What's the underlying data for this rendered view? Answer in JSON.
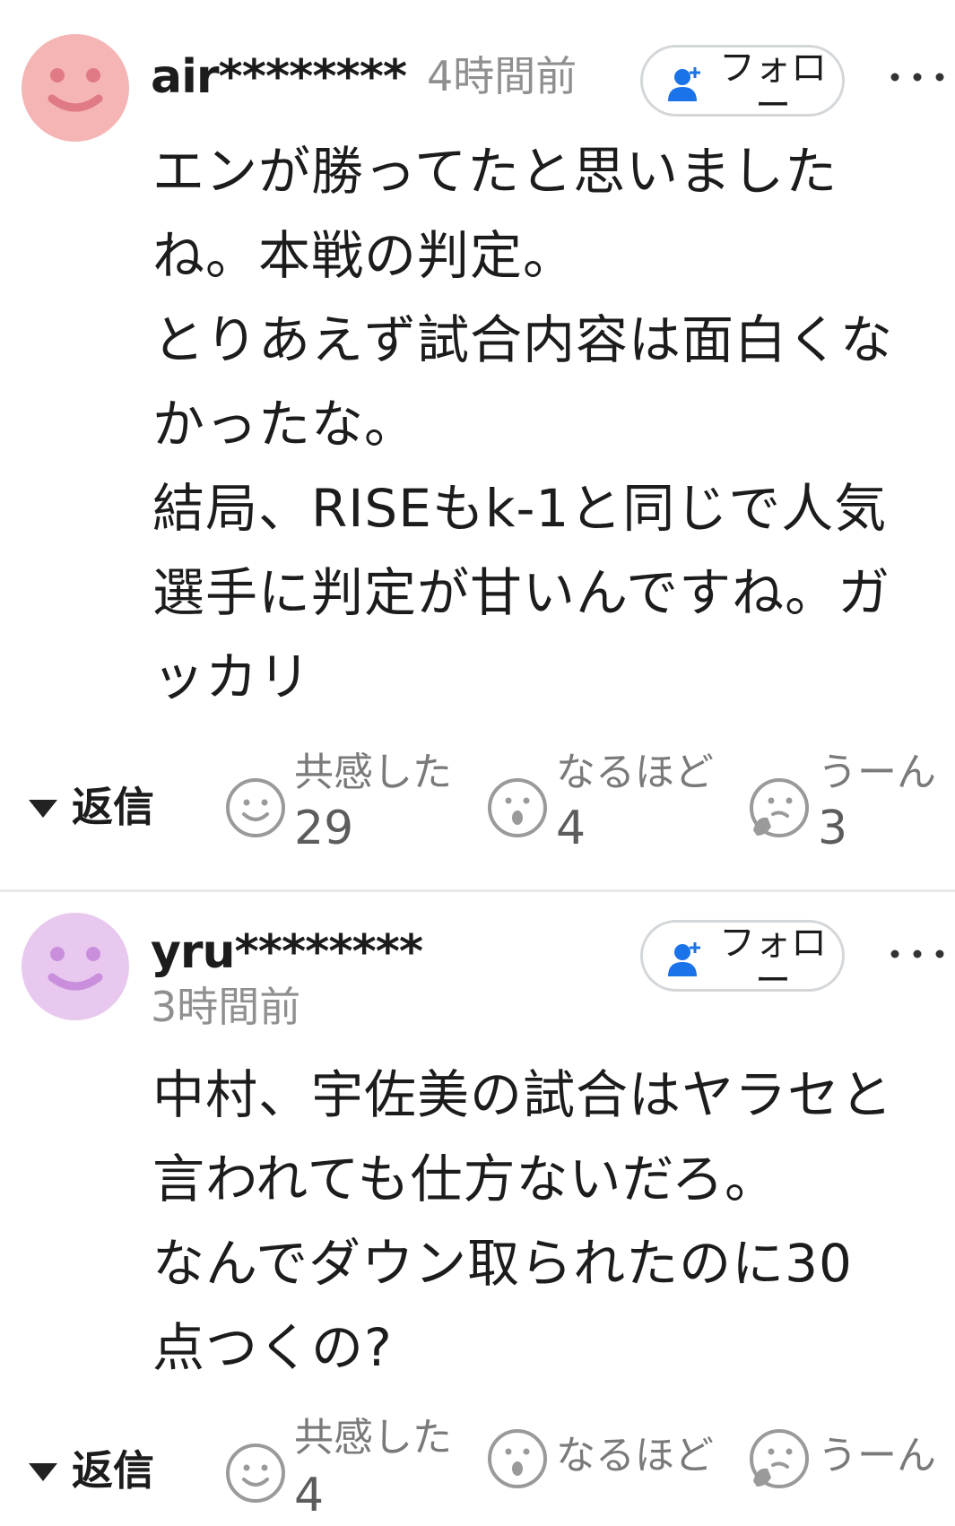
{
  "comments": [
    {
      "username": "air********",
      "time": "4時間前",
      "follow_label": "フォロー",
      "avatar_color": "#f5b5b5",
      "avatar_face_color": "#e07a84",
      "body": "エンが勝ってたと思いました\nね。本戦の判定。\nとりあえず試合内容は面白くな\nかったな。\n結局、RISEもk-1と同じで人気\n選手に判定が甘いんですね。ガ\nッカリ",
      "reply_label": "返信",
      "reactions": [
        {
          "label": "共感した",
          "count": "29",
          "icon": "smile-face-icon"
        },
        {
          "label": "なるほど",
          "count": "4",
          "icon": "surprised-face-icon"
        },
        {
          "label": "うーん",
          "count": "3",
          "icon": "thinking-face-icon"
        }
      ]
    },
    {
      "username": "yru********",
      "time": "3時間前",
      "follow_label": "フォロー",
      "avatar_color": "#e8c8ee",
      "avatar_face_color": "#c98fdc",
      "body": "中村、宇佐美の試合はヤラセと\n言われても仕方ないだろ。\nなんでダウン取られたのに30\n点つくの?",
      "reply_label": "返信",
      "reactions": [
        {
          "label": "共感した",
          "count": "4",
          "icon": "smile-face-icon"
        },
        {
          "label": "なるほど",
          "count": "",
          "icon": "surprised-face-icon"
        },
        {
          "label": "うーん",
          "count": "",
          "icon": "thinking-face-icon"
        }
      ]
    }
  ],
  "colors": {
    "follow_icon": "#1a73e8",
    "reaction_icon": "#9a9a9a",
    "divider": "#e6e8ea"
  }
}
